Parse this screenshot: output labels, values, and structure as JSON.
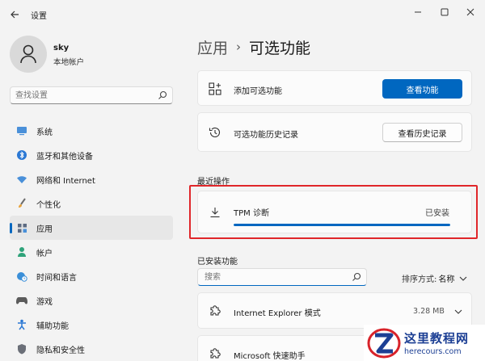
{
  "window": {
    "title": "设置"
  },
  "profile": {
    "name": "sky",
    "account_type": "本地帐户"
  },
  "sidebar_search": {
    "placeholder": "查找设置"
  },
  "sidebar": {
    "items": [
      {
        "label": "系统",
        "icon": "monitor-icon"
      },
      {
        "label": "蓝牙和其他设备",
        "icon": "bluetooth-icon"
      },
      {
        "label": "网络和 Internet",
        "icon": "wifi-icon"
      },
      {
        "label": "个性化",
        "icon": "brush-icon"
      },
      {
        "label": "应用",
        "icon": "apps-icon",
        "active": true
      },
      {
        "label": "帐户",
        "icon": "account-icon"
      },
      {
        "label": "时间和语言",
        "icon": "globe-clock-icon"
      },
      {
        "label": "游戏",
        "icon": "gamepad-icon"
      },
      {
        "label": "辅助功能",
        "icon": "accessibility-icon"
      },
      {
        "label": "隐私和安全性",
        "icon": "shield-icon"
      }
    ]
  },
  "breadcrumb": {
    "parent": "应用",
    "separator": "›",
    "current": "可选功能"
  },
  "add_feature": {
    "label": "添加可选功能",
    "button": "查看功能"
  },
  "history": {
    "label": "可选功能历史记录",
    "button": "查看历史记录"
  },
  "recent": {
    "section_title": "最近操作",
    "item_name": "TPM 诊断",
    "status": "已安装",
    "progress": 1.0
  },
  "installed": {
    "section_title": "已安装功能",
    "search_placeholder": "搜索",
    "sort_label": "排序方式:",
    "sort_value": "名称",
    "items": [
      {
        "name": "Internet Explorer 模式",
        "size": "3.28 MB"
      },
      {
        "name": "Microsoft 快速助手",
        "size": ""
      }
    ]
  },
  "watermark": {
    "text": "这里教程网",
    "url": "herecours.com"
  },
  "colors": {
    "accent": "#0067c0",
    "highlight": "#e0262a",
    "watermark": "#1c3f94"
  }
}
